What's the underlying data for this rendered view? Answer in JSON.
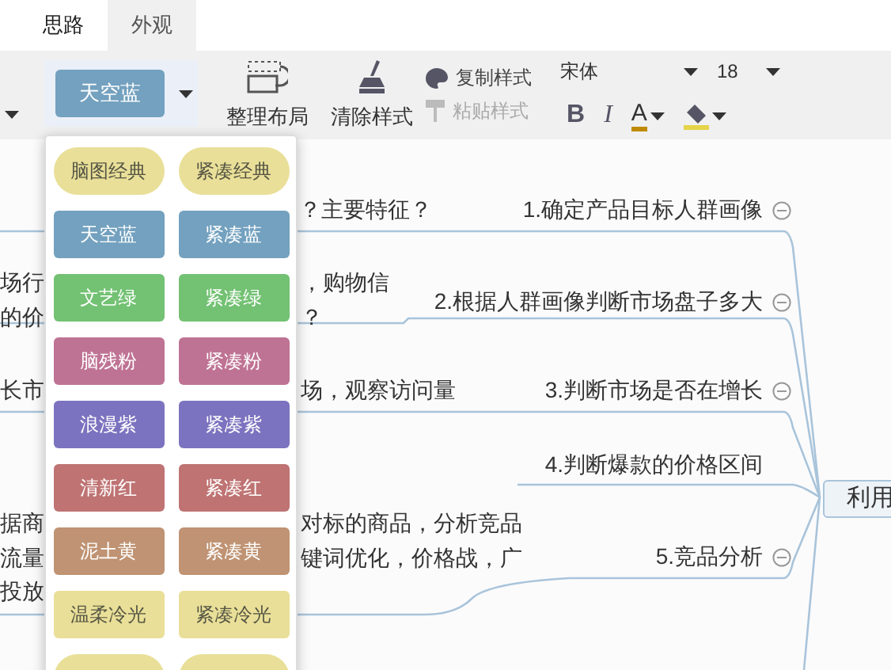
{
  "tabs": [
    {
      "label": "思路",
      "selected": false
    },
    {
      "label": "外观",
      "selected": true
    }
  ],
  "toolbar": {
    "theme_button": "天空蓝",
    "layout_button": "整理布局",
    "clear_style_button": "清除样式",
    "copy_style_button": {
      "label": "复制样式",
      "disabled": false
    },
    "paste_style_button": {
      "label": "粘贴样式",
      "disabled": true
    },
    "font_family": "宋体",
    "font_size": "18",
    "bold": "B",
    "italic": "I",
    "font_color": "A"
  },
  "theme_menu": [
    {
      "label": "脑图经典",
      "kind": "pill",
      "color": "#e9df98"
    },
    {
      "label": "紧凑经典",
      "kind": "pill",
      "color": "#e9df98"
    },
    {
      "label": "天空蓝",
      "kind": "box",
      "color": "#73a1bf"
    },
    {
      "label": "紧凑蓝",
      "kind": "box",
      "color": "#73a1bf"
    },
    {
      "label": "文艺绿",
      "kind": "box",
      "color": "#73c173"
    },
    {
      "label": "紧凑绿",
      "kind": "box",
      "color": "#73c173"
    },
    {
      "label": "脑残粉",
      "kind": "box",
      "color": "#bf7394"
    },
    {
      "label": "紧凑粉",
      "kind": "box",
      "color": "#bf7394"
    },
    {
      "label": "浪漫紫",
      "kind": "box",
      "color": "#7b73bf"
    },
    {
      "label": "紧凑紫",
      "kind": "box",
      "color": "#7b73bf"
    },
    {
      "label": "清新红",
      "kind": "box",
      "color": "#bf7373"
    },
    {
      "label": "紧凑红",
      "kind": "box",
      "color": "#bf7373"
    },
    {
      "label": "泥土黄",
      "kind": "box",
      "color": "#bf9373"
    },
    {
      "label": "紧凑黄",
      "kind": "box",
      "color": "#bf9373"
    },
    {
      "label": "温柔冷光",
      "kind": "light-box",
      "color": "#e9df98"
    },
    {
      "label": "紧凑冷光",
      "kind": "light-box",
      "color": "#e9df98"
    }
  ],
  "canvas": {
    "fragments": [
      "？主要特征？",
      "场行",
      "，购物信",
      "的价",
      "？",
      "长市",
      "场，观察访问量",
      "据商",
      "对标的商品，分析竞品",
      "流量",
      "键词优化，价格战，广",
      "投放"
    ],
    "nodes": [
      {
        "label": "1.确定产品目标人群画像",
        "collapsible": true
      },
      {
        "label": "2.根据人群画像判断市场盘子多大",
        "collapsible": true
      },
      {
        "label": "3.判断市场是否在增长",
        "collapsible": true
      },
      {
        "label": "4.判断爆款的价格区间",
        "collapsible": false
      },
      {
        "label": "5.竞品分析",
        "collapsible": true
      }
    ],
    "root": "利用"
  }
}
